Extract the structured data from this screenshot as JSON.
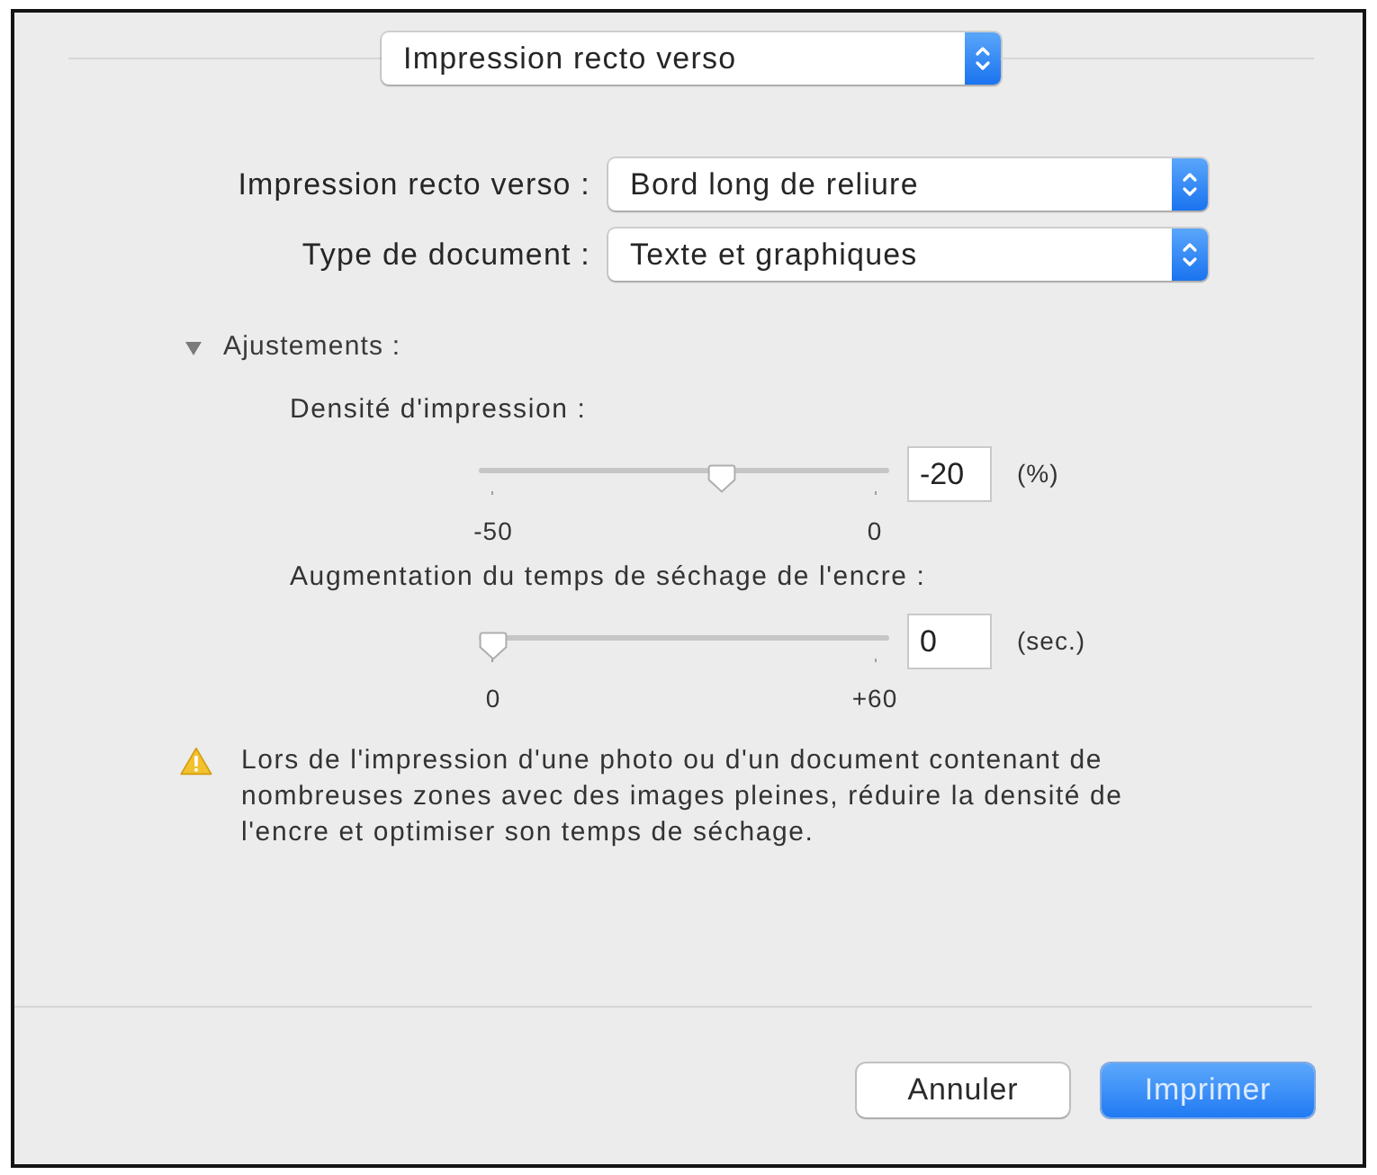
{
  "panel_popup": {
    "value": "Impression recto verso"
  },
  "options": [
    {
      "label": "Impression recto verso :",
      "value": "Bord long de reliure"
    },
    {
      "label": "Type de document :",
      "value": "Texte et graphiques"
    }
  ],
  "adjustments": {
    "title": "Ajustements :",
    "expanded": true,
    "sliders": [
      {
        "label": "Densité d'impression :",
        "level": 0.6,
        "value": "-20",
        "unit": "(%)",
        "min_label": "-50",
        "max_label": "0"
      },
      {
        "label": "Augmentation du temps de séchage de l'encre :",
        "level": 0,
        "value": "0",
        "unit": "(sec.)",
        "min_label": "0",
        "max_label": "+60"
      }
    ]
  },
  "warning": "Lors de l'impression d'une photo ou d'un document contenant de nombreuses zones avec des images pleines, réduire la densité de l'encre et optimiser son temps de séchage.",
  "buttons": [
    {
      "label": "Annuler",
      "kind": "secondary"
    },
    {
      "label": "Imprimer",
      "kind": "primary"
    }
  ]
}
